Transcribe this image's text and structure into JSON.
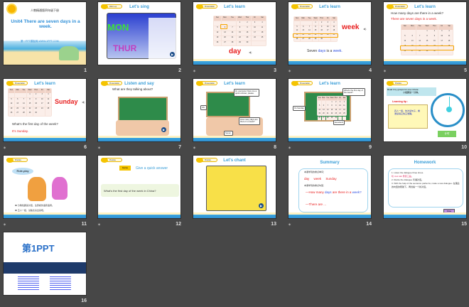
{
  "slides": [
    {
      "num": "1",
      "subtitle": "人教精通版四年级下册",
      "title": "Unit4 There are seven days in a week.",
      "site": "第一PPT模板网-WWW.1PPT.COM"
    },
    {
      "num": "2",
      "tag": "Warm-up",
      "title": "Let's sing",
      "big1": "MON",
      "big2": "THUR"
    },
    {
      "num": "3",
      "tag": "Presentation",
      "title": "Let's learn",
      "word": "day"
    },
    {
      "num": "4",
      "tag": "Presentation",
      "title": "Let's learn",
      "word": "week",
      "s1": "Seven",
      "s2": "days",
      "s3": "is a",
      "s4": "week."
    },
    {
      "num": "5",
      "tag": "Presentation",
      "title": "Let's learn",
      "q": "How many days are there in a week?",
      "a": "There are seven days in a week."
    },
    {
      "num": "6",
      "tag": "Presentation",
      "title": "Let's learn",
      "word": "Sunday",
      "q": "What's the first day of the week?",
      "a": "It's Sunday."
    },
    {
      "num": "7",
      "tag": "Presentation",
      "title": "Listen and say",
      "q": "What are they talking about?"
    },
    {
      "num": "8",
      "tag": "Presentation",
      "title": "Let's learn",
      "b1": "Hi, everyone! Give me a quick answer, please.",
      "b2": "OK.",
      "b3": "How many days are there in a week?",
      "b4": "Seven."
    },
    {
      "num": "9",
      "tag": "Presentation",
      "title": "Let's learn",
      "b1": "What's the first day of the week?",
      "b2": "It's Sunday.",
      "b3": "Excellent!"
    },
    {
      "num": "10",
      "tag": "Practice",
      "instr": "Read it by groups for one minute.",
      "instr_cn": "小组朗读一分钟。",
      "tip": "Learning tip :",
      "tip_text": "四人一组，依次读句子，看谁读得又快又准确。",
      "btn": "计时"
    },
    {
      "num": "11",
      "tag": "Practice",
      "label": "Role-play",
      "l1": "分角色朗读对话，注意模仿语音语调。",
      "l2": "五人一组，试着表演出来吧。"
    },
    {
      "num": "12",
      "tag": "Practice",
      "game": "Game",
      "title": "Give a quick answer",
      "q": "What's the first day of the week in China?"
    },
    {
      "num": "13",
      "tag": "Practice",
      "title": "Let's chant"
    },
    {
      "num": "14",
      "title": "Summary",
      "h1": "本课学到的重点单词：",
      "w1": "day",
      "w2": "week",
      "w3": "Sunday",
      "h2": "本课学到的重点句型：",
      "p1": "—How many",
      "p2": "days",
      "p3": "are there in a",
      "p4": "week?",
      "p5": "—There are ..."
    },
    {
      "num": "15",
      "title": "Homework",
      "l1": "1. Listen the dialogue three times.",
      "l1b": "听 Just talk 录音三遍。",
      "l2": "2. Recite the dialogue 背诵对话。",
      "l3": "3. With the help of the sentence partterns, make a new dialogue. 在课后的句型的帮助下，再创编一个新对话。",
      "btn": "Close"
    },
    {
      "num": "16",
      "logo": "第1PPT"
    }
  ],
  "calendar": {
    "headers": [
      "Sun",
      "Mon",
      "Tue",
      "Wed",
      "Thur",
      "Fri",
      "Sat"
    ],
    "days": [
      "",
      "",
      "",
      "1",
      "2",
      "3",
      "4",
      "5",
      "6",
      "7",
      "8",
      "9",
      "10",
      "11",
      "12",
      "13",
      "14",
      "15",
      "16",
      "17",
      "18",
      "19",
      "20",
      "21",
      "22",
      "23",
      "24",
      "25",
      "26",
      "27",
      "28",
      "29",
      "30",
      "",
      ""
    ]
  },
  "transition_icon": "slide-transition-icon"
}
